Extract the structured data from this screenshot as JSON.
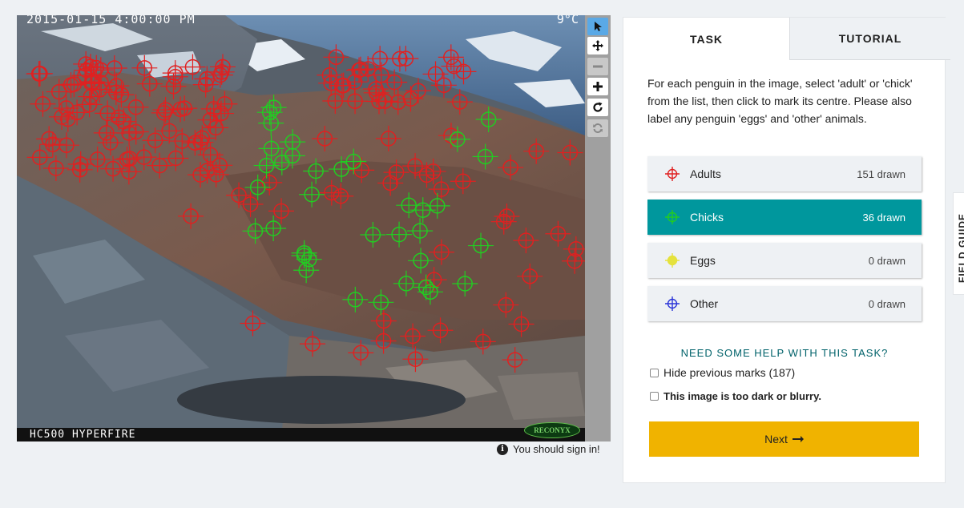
{
  "camera": {
    "timestamp": "2015-01-15 4:00:00 PM",
    "temperature": "9°C",
    "model": "HC500 HYPERFIRE",
    "brand": "RECONYX"
  },
  "toolbar": {
    "icons": [
      "pointer-icon",
      "move-icon",
      "zoom-out-icon",
      "zoom-in-icon",
      "rotate-icon",
      "reset-icon"
    ],
    "active_color": "#5aa9e6"
  },
  "signin_notice": "You should sign in!",
  "tabs": {
    "task": "TASK",
    "tutorial": "TUTORIAL"
  },
  "instructions": "For each penguin in the image, select 'adult' or 'chick' from the list, then click to mark its centre. Please also label any penguin 'eggs' and 'other' animals.",
  "tools": [
    {
      "label": "Adults",
      "count": "151 drawn",
      "color": "#e02020",
      "selected": false
    },
    {
      "label": "Chicks",
      "count": "36 drawn",
      "color": "#22cc22",
      "selected": true
    },
    {
      "label": "Eggs",
      "count": "0 drawn",
      "color": "#e5e23c",
      "selected": false
    },
    {
      "label": "Other",
      "count": "0 drawn",
      "color": "#2b35d8",
      "selected": false
    }
  ],
  "help_text": "NEED SOME HELP WITH THIS TASK?",
  "hide_marks_label": "Hide previous marks (187)",
  "too_dark_label": "This image is too dark or blurry.",
  "next_label": "Next",
  "field_guide_label": "FIELD GUIDE",
  "colors": {
    "selected_tool": "#00979d",
    "next_button": "#f0b300",
    "help_text": "#00626a"
  }
}
